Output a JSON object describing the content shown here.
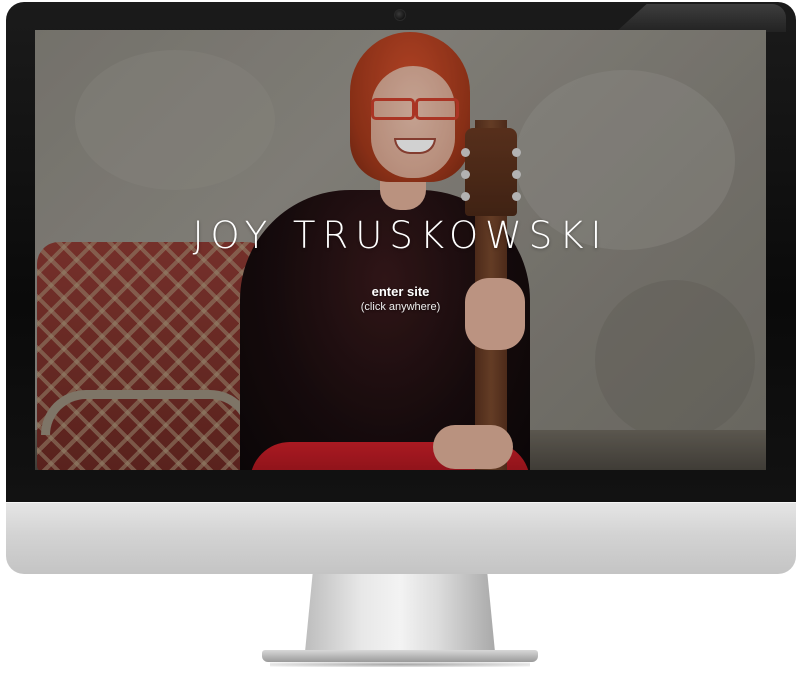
{
  "site": {
    "title": "JOY TRUSKOWSKI",
    "enter_label": "enter site",
    "enter_hint": "(click anywhere)"
  },
  "hero_image": {
    "subject": "woman-with-guitar-photo"
  },
  "colors": {
    "title_text": "#ffffff",
    "bezel": "#0a0a0a",
    "chin": "#d3d3d3",
    "skirt_red": "#d0202a"
  }
}
